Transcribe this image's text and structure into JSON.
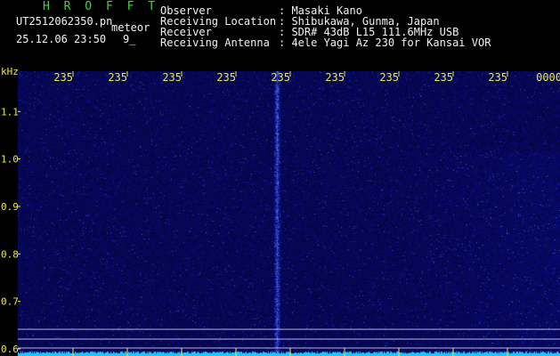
{
  "header": {
    "title": "H R O F F T",
    "filename": "UT2512062350.pn",
    "tag": "meteor",
    "datetime": "25.12.06 23:50",
    "count": "9_",
    "observer_label": "Observer",
    "observer_value": ": Masaki Kano",
    "location_label": "Receiving Location",
    "location_value": ": Shibukawa, Gunma, Japan",
    "receiver_label": "Receiver",
    "receiver_value": ": SDR# 43dB L15 111.6MHz USB",
    "antenna_label": "Receiving Antenna",
    "antenna_value": ": 4ele Yagi Az 230 for Kansai VOR"
  },
  "axes": {
    "y_unit": "kHz",
    "y_ticks": [
      {
        "label": "1.1",
        "value": 1.1
      },
      {
        "label": "1.0",
        "value": 1.0
      },
      {
        "label": "0.9",
        "value": 0.9
      },
      {
        "label": "0.8",
        "value": 0.8
      },
      {
        "label": "0.7",
        "value": 0.7
      },
      {
        "label": "0.6",
        "value": 0.6
      }
    ],
    "y_range": [
      0.585,
      1.185
    ],
    "x_ticks": [
      "235",
      "235",
      "235",
      "235",
      "235",
      "235",
      "235",
      "235",
      "235",
      "0000"
    ]
  },
  "colors": {
    "background": "#000000",
    "waterfall_base": "#0b0c8e",
    "signal": "#4f7dff",
    "axis_text": "#e8e84a",
    "header_green": "#3fd43f",
    "header_white": "#f2f2f2",
    "baseline": "#19c8ff"
  }
}
